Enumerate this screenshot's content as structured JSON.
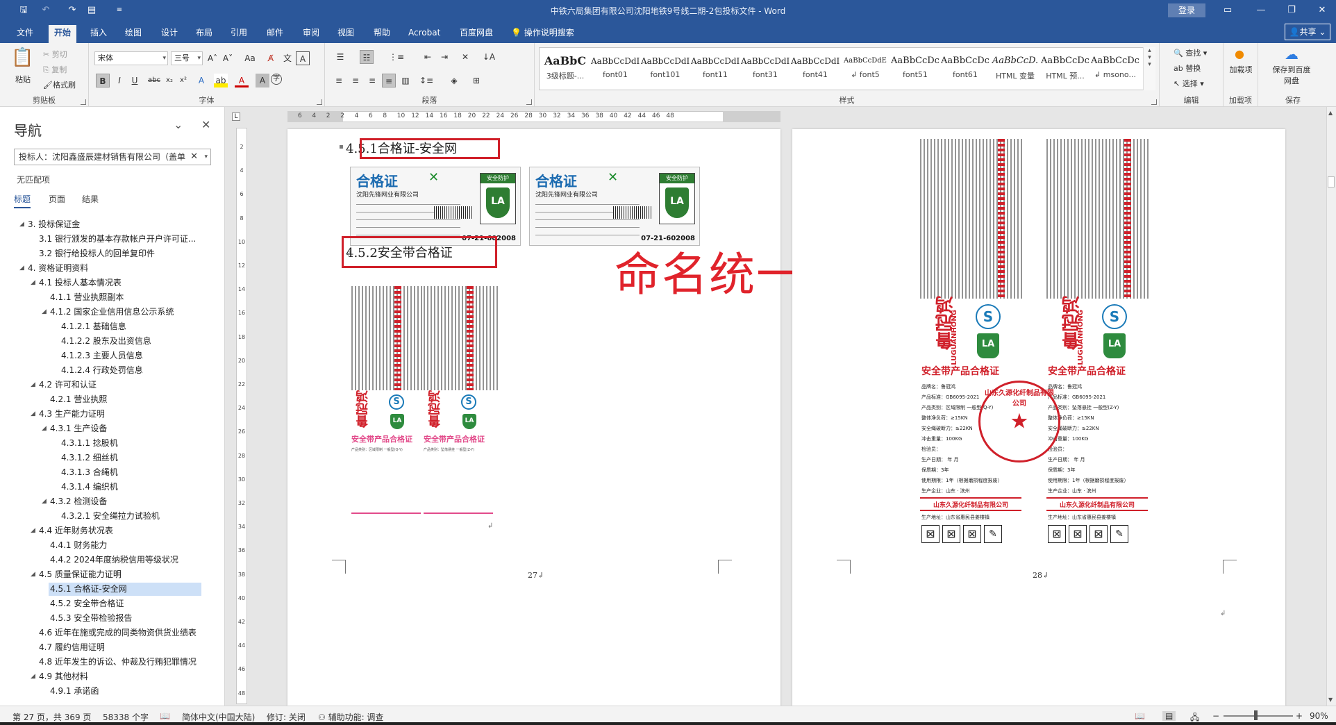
{
  "window": {
    "title": "中铁六局集团有限公司沈阳地铁9号线二期-2包投标文件  -  Word",
    "login": "登录",
    "share": "共享"
  },
  "tabs": [
    "文件",
    "开始",
    "插入",
    "绘图",
    "设计",
    "布局",
    "引用",
    "邮件",
    "审阅",
    "视图",
    "帮助",
    "Acrobat",
    "百度网盘"
  ],
  "active_tab": "开始",
  "tellme": "操作说明搜索",
  "ribbon": {
    "clipboard": {
      "paste": "粘贴",
      "cut": "剪切",
      "copy": "复制",
      "painter": "格式刷",
      "label": "剪贴板"
    },
    "font": {
      "name": "宋体",
      "size": "三号",
      "label": "字体"
    },
    "paragraph": {
      "label": "段落"
    },
    "styles": {
      "label": "样式",
      "items": [
        {
          "preview": "AaBbC",
          "name": "3级标题-..."
        },
        {
          "preview": "AaBbCcDdI",
          "name": "font01"
        },
        {
          "preview": "AaBbCcDdI",
          "name": "font101"
        },
        {
          "preview": "AaBbCcDdI",
          "name": "font11"
        },
        {
          "preview": "AaBbCcDdI",
          "name": "font31"
        },
        {
          "preview": "AaBbCcDdI",
          "name": "font41"
        },
        {
          "preview": "AaBbCcDdE",
          "name": "↲ font5"
        },
        {
          "preview": "AaBbCcDc",
          "name": "font51"
        },
        {
          "preview": "AaBbCcDc",
          "name": "font61"
        },
        {
          "preview": "AaBbCcD.",
          "name": "HTML 变量"
        },
        {
          "preview": "AaBbCcDc",
          "name": "HTML 预..."
        },
        {
          "preview": "AaBbCcDc",
          "name": "↲ msono..."
        }
      ]
    },
    "editing": {
      "find": "查找",
      "replace": "替换",
      "select": "选择",
      "label": "编辑"
    },
    "addins": {
      "btn": "加载项",
      "label": "加载项"
    },
    "save": {
      "btn": "保存到百度网盘",
      "label": "保存"
    }
  },
  "nav": {
    "title": "导航",
    "search_value": "投标人：沈阳鑫盛辰建材销售有限公司（盖单",
    "no_match": "无匹配项",
    "tabs": [
      "标题",
      "页面",
      "结果"
    ],
    "items": [
      {
        "level": 1,
        "text": "3. 投标保证金",
        "caret": "◢"
      },
      {
        "level": 2,
        "text": "3.1 银行颁发的基本存款帐户开户许可证..."
      },
      {
        "level": 2,
        "text": "3.2 银行给投标人的回单复印件"
      },
      {
        "level": 1,
        "text": "4. 资格证明资料",
        "caret": "◢"
      },
      {
        "level": 2,
        "text": "4.1 投标人基本情况表",
        "caret": "◢"
      },
      {
        "level": 3,
        "text": "4.1.1 营业执照副本"
      },
      {
        "level": 3,
        "text": "4.1.2 国家企业信用信息公示系统",
        "caret": "◢"
      },
      {
        "level": 4,
        "text": "4.1.2.1 基础信息"
      },
      {
        "level": 4,
        "text": "4.1.2.2 股东及出资信息"
      },
      {
        "level": 4,
        "text": "4.1.2.3 主要人员信息"
      },
      {
        "level": 4,
        "text": "4.1.2.4 行政处罚信息"
      },
      {
        "level": 2,
        "text": "4.2 许可和认证",
        "caret": "◢"
      },
      {
        "level": 3,
        "text": "4.2.1 营业执照"
      },
      {
        "level": 2,
        "text": "4.3 生产能力证明",
        "caret": "◢"
      },
      {
        "level": 3,
        "text": "4.3.1 生产设备",
        "caret": "◢"
      },
      {
        "level": 4,
        "text": "4.3.1.1 捻股机"
      },
      {
        "level": 4,
        "text": "4.3.1.2 细丝机"
      },
      {
        "level": 4,
        "text": "4.3.1.3 合绳机"
      },
      {
        "level": 4,
        "text": "4.3.1.4 编织机"
      },
      {
        "level": 3,
        "text": "4.3.2 检测设备",
        "caret": "◢"
      },
      {
        "level": 4,
        "text": "4.3.2.1 安全绳拉力试验机"
      },
      {
        "level": 2,
        "text": "4.4 近年财务状况表",
        "caret": "◢"
      },
      {
        "level": 3,
        "text": "4.4.1 财务能力"
      },
      {
        "level": 3,
        "text": "4.4.2 2024年度纳税信用等级状况"
      },
      {
        "level": 2,
        "text": "4.5 质量保证能力证明",
        "caret": "◢"
      },
      {
        "level": 3,
        "text": "4.5.1 合格证-安全网",
        "selected": true
      },
      {
        "level": 3,
        "text": "4.5.2 安全带合格证"
      },
      {
        "level": 3,
        "text": "4.5.3 安全带检验报告"
      },
      {
        "level": 2,
        "text": "4.6 近年在施或完成的同类物资供货业绩表"
      },
      {
        "level": 2,
        "text": "4.7 履约信用证明"
      },
      {
        "level": 2,
        "text": "4.8 近年发生的诉讼、仲裁及行贿犯罪情况"
      },
      {
        "level": 2,
        "text": "4.9 其他材料",
        "caret": "◢"
      },
      {
        "level": 3,
        "text": "4.9.1 承诺函"
      }
    ]
  },
  "ruler": {
    "h_numbers": [
      "6",
      "4",
      "2",
      "2",
      "4",
      "6",
      "8",
      "10",
      "12",
      "14",
      "16",
      "18",
      "20",
      "22",
      "24",
      "26",
      "28",
      "30",
      "32",
      "34",
      "36",
      "38",
      "40",
      "42",
      "44",
      "46",
      "48"
    ],
    "v_numbers": [
      "2",
      "4",
      "6",
      "8",
      "10",
      "12",
      "14",
      "16",
      "18",
      "20",
      "22",
      "24",
      "26",
      "28",
      "30",
      "32",
      "34",
      "36",
      "38",
      "40",
      "42",
      "44",
      "46",
      "48"
    ]
  },
  "doc": {
    "page27": {
      "heading1": "4.5.1合格证-安全网",
      "heading2": "4.5.2安全带合格证",
      "page_num": "27↲",
      "cert": {
        "title": "合格证",
        "company": "沈阳先锋网业有限公司",
        "shield_top": "安全防护",
        "shield": "LA",
        "code": "07-21-602008"
      }
    },
    "annotation": "命名统一一下",
    "page28": {
      "page_num": "28↲"
    },
    "belt_label": {
      "brand": "鲁冠鸿",
      "brand_en": "LUGUANHONG",
      "title": "安全带产品合格证",
      "fields_a": [
        "品牌名：鲁冠鸿",
        "产品标准：GB6095-2021",
        "产品类别：区域限制  一般型(Q-Y)",
        "整体净负荷：≥15KN",
        "安全绳破断力：≥22KN",
        "冲击重量：100KG",
        "检验员：",
        "生产日期：    年    月",
        "保质期：3年",
        "使用期限：1年（根据磨损程度报废）",
        "生产企业：山东 · 滨州"
      ],
      "fields_b": [
        "品牌名：鲁冠鸿",
        "产品标准：GB6095-2021",
        "产品类别：坠落悬挂  一般型(Z-Y)",
        "整体净负荷：≥15KN",
        "安全绳破断力：≥22KN",
        "冲击重量：100KG",
        "检验员：",
        "生产日期：    年    月",
        "保质期：3年",
        "使用期限：1年（根据磨损程度报废）",
        "生产企业：山东 · 滨州"
      ],
      "maker": "山东久源化纤制品有限公司",
      "address": "生产地址：山东省惠民县姜楼镇",
      "icons": [
        "禁止撞击",
        "严禁接触",
        "严禁火烧",
        "严禁尖刺"
      ],
      "stamp": "山东久源化纤制品有限公司"
    }
  },
  "status": {
    "page": "第 27 页，共 369 页",
    "words": "58338 个字",
    "lang": "简体中文(中国大陆)",
    "track": "修订: 关闭",
    "access": "辅助功能: 调查",
    "zoom": "90%"
  },
  "colors": {
    "brand": "#2b579a",
    "annot": "#e0232b"
  }
}
